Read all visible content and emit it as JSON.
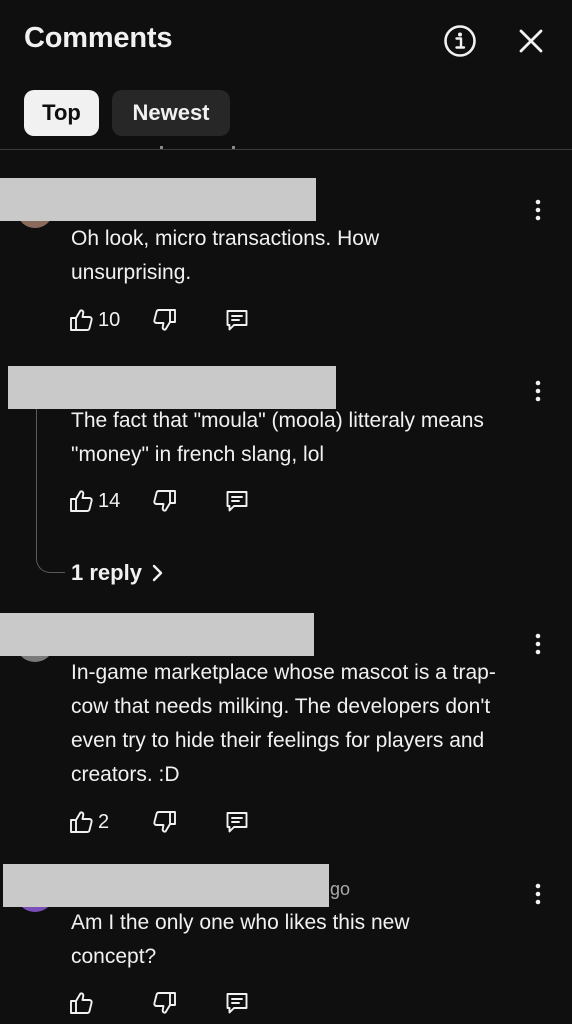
{
  "header": {
    "title": "Comments",
    "info_icon": "info-icon",
    "close_icon": "close-icon"
  },
  "filters": {
    "top_label": "Top",
    "newest_label": "Newest",
    "selected": "Top"
  },
  "comments": [
    {
      "text": "Oh look, micro transactions. How unsurprising.",
      "likes": "10"
    },
    {
      "text": "The fact that \"moula\" (moola) litteraly means \"money\" in french slang, lol",
      "likes": "14",
      "replies_label": "1 reply"
    },
    {
      "text": "In-game marketplace whose mascot is a trap-cow that needs milking. The developers don't even try to hide their feelings for players and creators. :D",
      "likes": "2"
    },
    {
      "meta_fragment": "go",
      "text": "Am I the only one who likes this new concept?",
      "likes": ""
    }
  ],
  "colors": {
    "background": "#0f0f0f",
    "text": "#f1f1f1",
    "chip_selected_bg": "#f1f1f1",
    "chip_bg": "#272727",
    "redaction": "#c9c9c9"
  }
}
